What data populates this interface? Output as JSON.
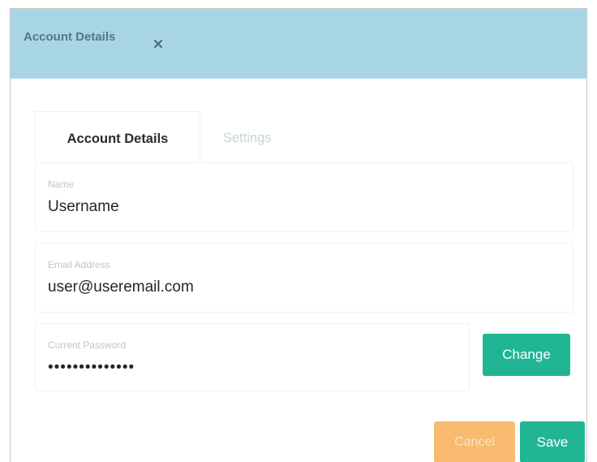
{
  "header": {
    "title": "Account Details",
    "close_icon": "close-icon"
  },
  "tabs": [
    {
      "label": "Account Details",
      "active": true
    },
    {
      "label": "Settings",
      "active": false
    }
  ],
  "fields": {
    "name": {
      "label": "Name",
      "value": "Username"
    },
    "email": {
      "label": "Email Address",
      "value": "user@useremail.com"
    },
    "password": {
      "label": "Current Password",
      "value": "••••••••••••••"
    }
  },
  "buttons": {
    "change": "Change",
    "cancel": "Cancel",
    "save": "Save"
  },
  "colors": {
    "header_bg": "#a7d5e6",
    "primary": "#20b593",
    "cancel": "#f7ba6e"
  }
}
